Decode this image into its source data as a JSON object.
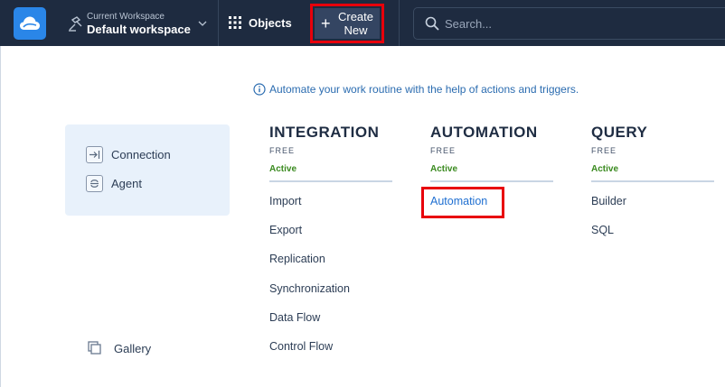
{
  "topbar": {
    "workspace_sub": "Current Workspace",
    "workspace_name": "Default workspace",
    "objects_label": "Objects",
    "create_label_line1": "Create",
    "create_label_line2": "New",
    "search_placeholder": "Search...",
    "colors": {
      "bar": "#1e2b40",
      "logo": "#2a86e8",
      "highlight": "#e8000b"
    }
  },
  "info": {
    "icon": "info-icon",
    "text": "Automate your work routine with the help of actions and triggers."
  },
  "left_panel": {
    "items": [
      {
        "label": "Connection",
        "icon": "connection-icon"
      },
      {
        "label": "Agent",
        "icon": "agent-icon"
      }
    ],
    "gallery_label": "Gallery"
  },
  "columns": [
    {
      "title": "INTEGRATION",
      "tier": "FREE",
      "status": "Active",
      "links": [
        "Import",
        "Export",
        "Replication",
        "Synchronization",
        "Data Flow",
        "Control Flow"
      ]
    },
    {
      "title": "AUTOMATION",
      "tier": "FREE",
      "status": "Active",
      "links": [
        "Automation"
      ]
    },
    {
      "title": "QUERY",
      "tier": "FREE",
      "status": "Active",
      "links": [
        "Builder",
        "SQL"
      ]
    }
  ]
}
